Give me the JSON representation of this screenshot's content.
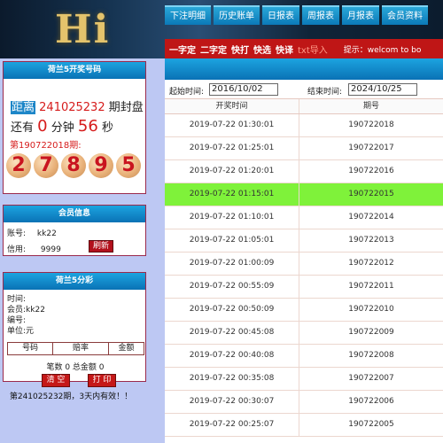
{
  "header": {
    "logo": "Hi",
    "nav": [
      "下注明细",
      "历史账单",
      "日报表",
      "周报表",
      "月报表",
      "会员资料"
    ],
    "subnav": [
      "一字定",
      "二字定",
      "快打",
      "快选",
      "快译"
    ],
    "subnav_txt": "txt导入",
    "tip": "提示：welcom to bo"
  },
  "draw_panel": {
    "title": "荷兰5开奖号码",
    "label": "距离",
    "draw_no": "241025232",
    "suffix": "期封盘",
    "countdown_prefix": "还有",
    "minutes": "0",
    "min_unit": "分钟",
    "seconds": "56",
    "sec_unit": "秒",
    "latest_label": "第190722018期:",
    "balls": [
      "2",
      "7",
      "8",
      "9",
      "5"
    ]
  },
  "member_panel": {
    "title": "会员信息",
    "account_label": "账号:",
    "account_value": "kk22",
    "credit_label": "信用:",
    "credit_value": "9999",
    "refresh": "刷新"
  },
  "bet_panel": {
    "title": "荷兰5分彩",
    "time_label": "时间:",
    "member_label": "会员:",
    "member_value": "kk22",
    "serial_label": "编号:",
    "unit_label": "单位:",
    "unit_value": "元",
    "columns": [
      "号码",
      "赔率",
      "金额"
    ],
    "totals": "笔数 0 总金额 0",
    "clear": "清 空",
    "print": "打 印",
    "note": "第241025232期，3天内有效！！"
  },
  "right": {
    "start_label": "起始时间:",
    "start_value": "2016/10/02",
    "end_label": "结束时间:",
    "end_value": "2024/10/25",
    "columns": [
      "开奖时间",
      "期号"
    ],
    "rows": [
      {
        "time": "2019-07-22 01:30:01",
        "no": "190722018"
      },
      {
        "time": "2019-07-22 01:25:01",
        "no": "190722017"
      },
      {
        "time": "2019-07-22 01:20:01",
        "no": "190722016"
      },
      {
        "time": "2019-07-22 01:15:01",
        "no": "190722015"
      },
      {
        "time": "2019-07-22 01:10:01",
        "no": "190722014"
      },
      {
        "time": "2019-07-22 01:05:01",
        "no": "190722013"
      },
      {
        "time": "2019-07-22 01:00:09",
        "no": "190722012"
      },
      {
        "time": "2019-07-22 00:55:09",
        "no": "190722011"
      },
      {
        "time": "2019-07-22 00:50:09",
        "no": "190722010"
      },
      {
        "time": "2019-07-22 00:45:08",
        "no": "190722009"
      },
      {
        "time": "2019-07-22 00:40:08",
        "no": "190722008"
      },
      {
        "time": "2019-07-22 00:35:08",
        "no": "190722007"
      },
      {
        "time": "2019-07-22 00:30:07",
        "no": "190722006"
      },
      {
        "time": "2019-07-22 00:25:07",
        "no": "190722005"
      }
    ],
    "highlight_index": 3,
    "highlight_color": "#7ff23a"
  }
}
